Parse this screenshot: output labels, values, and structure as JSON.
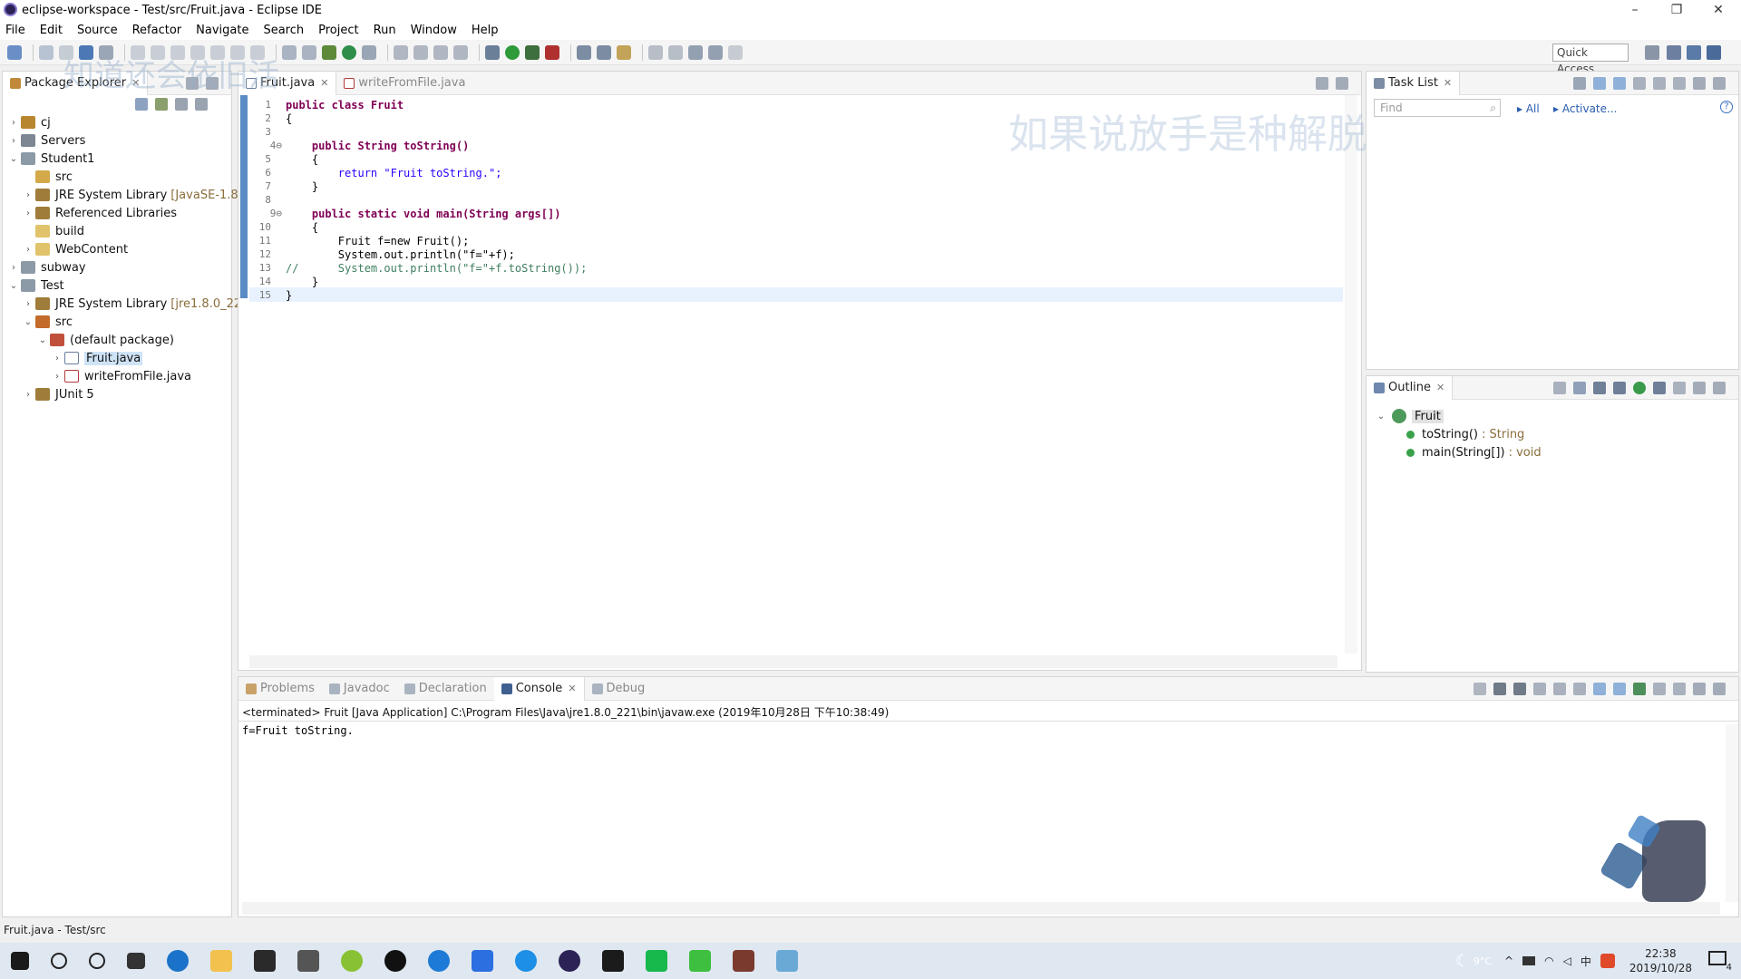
{
  "window": {
    "title": "eclipse-workspace - Test/src/Fruit.java - Eclipse IDE",
    "minimize": "–",
    "restore": "❐",
    "close": "✕"
  },
  "menu": [
    "File",
    "Edit",
    "Source",
    "Refactor",
    "Navigate",
    "Search",
    "Project",
    "Run",
    "Window",
    "Help"
  ],
  "toolbar": {
    "quick_access": "Quick Access"
  },
  "package_explorer": {
    "tab_label": "Package Explorer",
    "items": [
      {
        "label": "cj",
        "extra": "",
        "twisty": "›"
      },
      {
        "label": "Servers",
        "extra": "",
        "twisty": "›"
      },
      {
        "label": "Student1",
        "extra": "",
        "twisty": "⌄"
      },
      {
        "label": "src",
        "extra": "",
        "twisty": ""
      },
      {
        "label": "JRE System Library",
        "extra": "[JavaSE-1.8]",
        "twisty": "›"
      },
      {
        "label": "Referenced Libraries",
        "extra": "",
        "twisty": "›"
      },
      {
        "label": "build",
        "extra": "",
        "twisty": ""
      },
      {
        "label": "WebContent",
        "extra": "",
        "twisty": "›"
      },
      {
        "label": "subway",
        "extra": "",
        "twisty": "›"
      },
      {
        "label": "Test",
        "extra": "",
        "twisty": "⌄"
      },
      {
        "label": "JRE System Library",
        "extra": "[jre1.8.0_221]",
        "twisty": "›"
      },
      {
        "label": "src",
        "extra": "",
        "twisty": "⌄"
      },
      {
        "label": "(default package)",
        "extra": "",
        "twisty": "⌄"
      },
      {
        "label": "Fruit.java",
        "extra": "",
        "twisty": "›"
      },
      {
        "label": "writeFromFile.java",
        "extra": "",
        "twisty": "›"
      },
      {
        "label": "JUnit 5",
        "extra": "",
        "twisty": "›"
      }
    ]
  },
  "editor": {
    "tabs": [
      "Fruit.java",
      "writeFromFile.java"
    ],
    "line_numbers": [
      "1",
      "2",
      "3",
      "4⊖",
      "5",
      "6",
      "7",
      "8",
      "9⊖",
      "10",
      "11",
      "12",
      "13",
      "14",
      "15"
    ],
    "lines": [
      "public class Fruit",
      "{",
      "",
      "    public String toString()",
      "    {",
      "        return \"Fruit toString.\";",
      "    }",
      "",
      "    public static void main(String args[])",
      "    {",
      "        Fruit f=new Fruit();",
      "        System.out.println(\"f=\"+f);",
      "//      System.out.println(\"f=\"+f.toString());",
      "    }",
      "}"
    ]
  },
  "overlay_text": {
    "left": "知道还会依旧活",
    "right": "如果说放手是种解脱挽留又有何用"
  },
  "task_list": {
    "tab_label": "Task List",
    "find_placeholder": "Find",
    "all": "All",
    "activate": "Activate..."
  },
  "outline": {
    "tab_label": "Outline",
    "root": "Fruit",
    "members": [
      {
        "name": "toString()",
        "type": ": String"
      },
      {
        "name": "main(String[])",
        "type": ": void"
      }
    ]
  },
  "console": {
    "tabs": [
      "Problems",
      "Javadoc",
      "Declaration",
      "Console",
      "Debug"
    ],
    "header": "<terminated> Fruit [Java Application] C:\\Program Files\\Java\\jre1.8.0_221\\bin\\javaw.exe (2019年10月28日 下午10:38:49)",
    "output": "f=Fruit toString."
  },
  "status_bar": {
    "text": "Fruit.java - Test/src"
  },
  "taskbar": {
    "time": "22:38",
    "date": "2019/10/28",
    "temperature": "9°C",
    "notification_count": "4"
  }
}
